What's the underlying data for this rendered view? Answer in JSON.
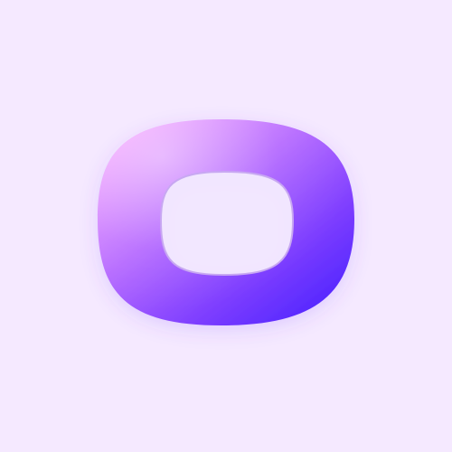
{
  "canvas": {
    "background_color": "#F5E9FF"
  },
  "logo": {
    "icon": "squircle-ring-icon",
    "gradient_colors": [
      "#F4A6FF",
      "#B66BFF",
      "#7B3CFF",
      "#4A22FF"
    ],
    "hole_color": "#F2E7FF",
    "hole_edge_color": "#C8A8F2"
  }
}
